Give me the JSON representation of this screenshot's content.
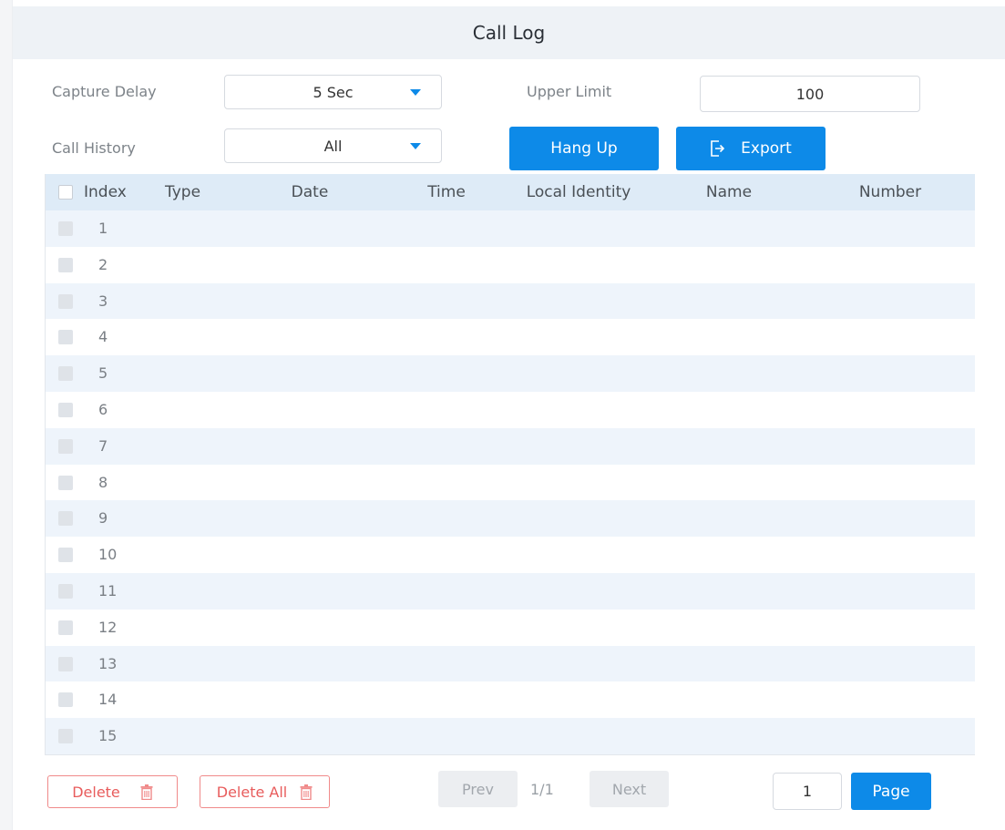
{
  "page": {
    "title": "Call Log"
  },
  "settings": {
    "capture_delay_label": "Capture Delay",
    "capture_delay_value": "5 Sec",
    "upper_limit_label": "Upper Limit",
    "upper_limit_value": "100",
    "call_history_label": "Call History",
    "call_history_value": "All"
  },
  "actions": {
    "hang_up": "Hang Up",
    "export": "Export"
  },
  "table": {
    "columns": [
      "Index",
      "Type",
      "Date",
      "Time",
      "Local Identity",
      "Name",
      "Number"
    ],
    "rows": [
      {
        "index": "1"
      },
      {
        "index": "2"
      },
      {
        "index": "3"
      },
      {
        "index": "4"
      },
      {
        "index": "5"
      },
      {
        "index": "6"
      },
      {
        "index": "7"
      },
      {
        "index": "8"
      },
      {
        "index": "9"
      },
      {
        "index": "10"
      },
      {
        "index": "11"
      },
      {
        "index": "12"
      },
      {
        "index": "13"
      },
      {
        "index": "14"
      },
      {
        "index": "15"
      }
    ]
  },
  "footer": {
    "delete": "Delete",
    "delete_all": "Delete All",
    "prev": "Prev",
    "page_indicator": "1/1",
    "next": "Next",
    "page_input": "1",
    "page_button": "Page"
  },
  "colors": {
    "accent": "#0d8ae8",
    "danger": "#e85c5c",
    "header_bg": "#eef2f6",
    "table_head_bg": "#deebf7"
  }
}
